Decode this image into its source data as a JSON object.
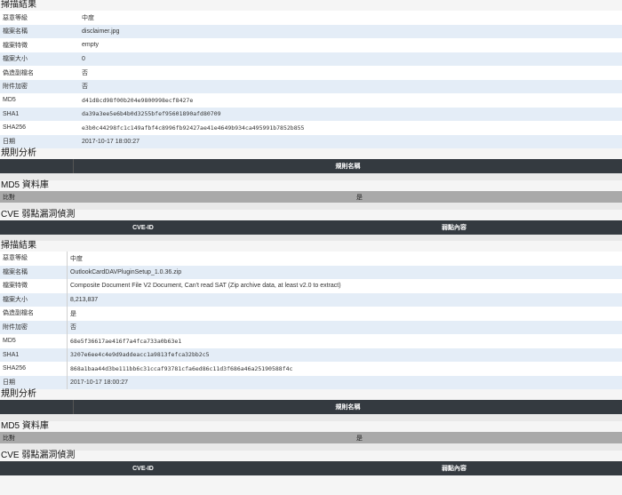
{
  "blocks": [
    {
      "scan_title": "掃描結果",
      "rows": [
        {
          "label": "惡意等級",
          "value": "中度"
        },
        {
          "label": "檔案名稱",
          "value": "disclaimer.jpg"
        },
        {
          "label": "檔案特徵",
          "value": "empty"
        },
        {
          "label": "檔案大小",
          "value": "0"
        },
        {
          "label": "偽造副檔名",
          "value": "否"
        },
        {
          "label": "附件加密",
          "value": "否"
        },
        {
          "label": "MD5",
          "value": "d41d8cd98f00b204e9800998ecf8427e"
        },
        {
          "label": "SHA1",
          "value": "da39a3ee5e6b4b0d3255bfef95601890afd80709"
        },
        {
          "label": "SHA256",
          "value": "e3b0c44298fc1c149afbf4c8996fb92427ae41e4649b934ca495991b7852b855"
        },
        {
          "label": "日期",
          "value": "2017-10-17 18:00:27"
        }
      ],
      "rule_title": "規則分析",
      "rule_header": "規則名稱",
      "md5_title": "MD5 資料庫",
      "md5_left": "比對",
      "md5_right": "是",
      "cve_title": "CVE 弱點漏洞偵測",
      "cve_col1": "CVE-ID",
      "cve_col2": "弱點內容"
    },
    {
      "scan_title": "掃描結果",
      "rows": [
        {
          "label": "惡意等級",
          "value": "中度"
        },
        {
          "label": "檔案名稱",
          "value": "OutlookCardDAVPluginSetup_1.0.36.zip"
        },
        {
          "label": "檔案特徵",
          "value": "Composite Document File V2 Document, Can't read SAT (Zip archive data, at least v2.0 to extract)"
        },
        {
          "label": "檔案大小",
          "value": "8,213,837"
        },
        {
          "label": "偽造副檔名",
          "value": "是"
        },
        {
          "label": "附件加密",
          "value": "否"
        },
        {
          "label": "MD5",
          "value": "68e5f36617ae416f7a4fca733a0b63e1"
        },
        {
          "label": "SHA1",
          "value": "3207e6ee4c4e9d9addeacc1a9813fefca32bb2c5"
        },
        {
          "label": "SHA256",
          "value": "868a1baa44d3be111bb6c31ccaf93781cfa6ed86c11d3f686a46a25190588f4c"
        },
        {
          "label": "日期",
          "value": "2017-10-17 18:00:27"
        }
      ],
      "rule_title": "規則分析",
      "rule_header": "規則名稱",
      "md5_title": "MD5 資料庫",
      "md5_left": "比對",
      "md5_right": "是",
      "cve_title": "CVE 弱點漏洞偵測",
      "cve_col1": "CVE-ID",
      "cve_col2": "弱點內容"
    }
  ]
}
